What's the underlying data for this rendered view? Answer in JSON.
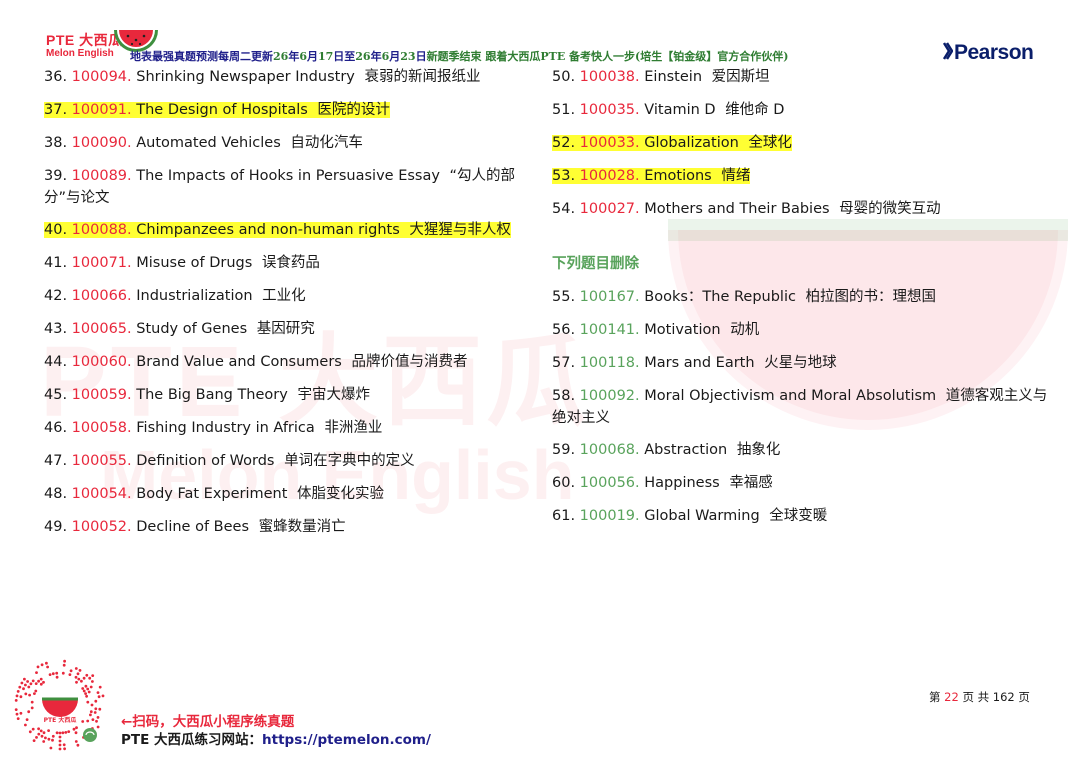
{
  "header": {
    "logo_pte": "PTE 大西瓜",
    "logo_en": "Melon English",
    "notice_a": "地表最强真题预测每周二更新",
    "notice_b": "26",
    "notice_c": "年",
    "notice_d": "6",
    "notice_e": "月",
    "notice_f": "17",
    "notice_g": "日至",
    "notice_h": "26",
    "notice_i": "年",
    "notice_j": "6",
    "notice_k": "月",
    "notice_l": "23",
    "notice_m": "日",
    "notice_n": "新题季结束 跟着大西瓜PTE 备考快人一步(培生【铂金级】官方合作伙伴)",
    "brand": "Pearson"
  },
  "left_items": [
    {
      "num": "36.",
      "code": "100094.",
      "en": "Shrinking Newspaper Industry",
      "cn": "衰弱的新闻报纸业",
      "highlight": false
    },
    {
      "num": "37.",
      "code": "100091.",
      "en": "The Design of Hospitals",
      "cn": "医院的设计",
      "highlight": true
    },
    {
      "num": "38.",
      "code": "100090.",
      "en": "Automated Vehicles",
      "cn": "自动化汽车",
      "highlight": false
    },
    {
      "num": "39.",
      "code": "100089.",
      "en": "The Impacts of Hooks in Persuasive Essay",
      "cn": "“勾人的部分”与论文",
      "highlight": false
    },
    {
      "num": "40.",
      "code": "100088.",
      "en": "Chimpanzees and non-human rights",
      "cn": "大猩猩与非人权",
      "highlight": true
    },
    {
      "num": "41.",
      "code": "100071.",
      "en": "Misuse of Drugs",
      "cn": "误食药品",
      "highlight": false
    },
    {
      "num": "42.",
      "code": "100066.",
      "en": "Industrialization",
      "cn": "工业化",
      "highlight": false
    },
    {
      "num": "43.",
      "code": "100065.",
      "en": "Study of Genes",
      "cn": "基因研究",
      "highlight": false
    },
    {
      "num": "44.",
      "code": "100060.",
      "en": "Brand Value and Consumers",
      "cn": "品牌价值与消费者",
      "highlight": false
    },
    {
      "num": "45.",
      "code": "100059.",
      "en": "The Big Bang Theory",
      "cn": "宇宙大爆炸",
      "highlight": false
    },
    {
      "num": "46.",
      "code": "100058.",
      "en": "Fishing Industry in Africa",
      "cn": "非洲渔业",
      "highlight": false
    },
    {
      "num": "47.",
      "code": "100055.",
      "en": "Definition of Words",
      "cn": "单词在字典中的定义",
      "highlight": false
    },
    {
      "num": "48.",
      "code": "100054.",
      "en": "Body Fat Experiment",
      "cn": "体脂变化实验",
      "highlight": false
    },
    {
      "num": "49.",
      "code": "100052.",
      "en": "Decline of Bees",
      "cn": "蜜蜂数量消亡",
      "highlight": false
    }
  ],
  "right_items": [
    {
      "num": "50.",
      "code": "100038.",
      "en": "Einstein",
      "cn": "爱因斯坦",
      "highlight": false
    },
    {
      "num": "51.",
      "code": "100035.",
      "en": "Vitamin D",
      "cn": "维他命 D",
      "highlight": false
    },
    {
      "num": "52.",
      "code": "100033.",
      "en": "Globalization",
      "cn": "全球化",
      "highlight": true
    },
    {
      "num": "53.",
      "code": "100028.",
      "en": "Emotions",
      "cn": "情绪",
      "highlight": true
    },
    {
      "num": "54.",
      "code": "100027.",
      "en": "Mothers and Their Babies",
      "cn": "母婴的微笑互动",
      "highlight": false
    }
  ],
  "section_deleted": {
    "heading": "下列题目删除",
    "items": [
      {
        "num": "55.",
        "code": "100167.",
        "en": "Books：The Republic",
        "cn": "柏拉图的书：理想国"
      },
      {
        "num": "56.",
        "code": "100141.",
        "en": "Motivation",
        "cn": "动机"
      },
      {
        "num": "57.",
        "code": "100118.",
        "en": "Mars and Earth",
        "cn": "火星与地球"
      },
      {
        "num": "58.",
        "code": "100092.",
        "en": "Moral Objectivism and Moral Absolutism",
        "cn": "道德客观主义与绝对主义"
      },
      {
        "num": "59.",
        "code": "100068.",
        "en": "Abstraction",
        "cn": "抽象化"
      },
      {
        "num": "60.",
        "code": "100056.",
        "en": "Happiness",
        "cn": "幸福感"
      },
      {
        "num": "61.",
        "code": "100019.",
        "en": "Global Warming",
        "cn": "全球变暖"
      }
    ]
  },
  "footer": {
    "qr_label": "PTE 大西瓜",
    "line1": "←扫码，大西瓜小程序练真题",
    "line2_label": "PTE 大西瓜练习网站：",
    "line2_url": "https://ptemelon.com/",
    "page_a": "第",
    "page_cur": "22",
    "page_b": "页 共",
    "page_total": "162",
    "page_c": "页"
  },
  "watermark": {
    "line1": "PTE 大西瓜",
    "line2": "Melon English"
  },
  "colors": {
    "red": "#e8283c",
    "green": "#59a35c",
    "highlight": "#ffff33",
    "navy": "#1f1f8a"
  }
}
